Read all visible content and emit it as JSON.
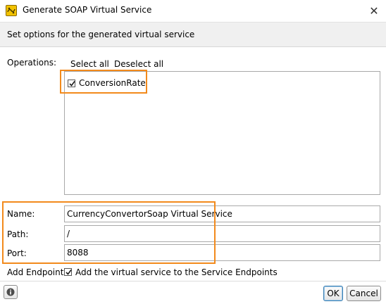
{
  "window": {
    "title": "Generate SOAP Virtual Service",
    "close_glyph": "✕"
  },
  "header": {
    "subtitle": "Set options for the generated virtual service"
  },
  "operations": {
    "label": "Operations:",
    "select_all": "Select all",
    "deselect_all": "Deselect all",
    "items": [
      {
        "label": "ConversionRate",
        "checked": true
      }
    ]
  },
  "form": {
    "name_label": "Name:",
    "name_value": "CurrencyConvertorSoap Virtual Service",
    "path_label": "Path:",
    "path_value": "/",
    "port_label": "Port:",
    "port_value": "8088",
    "endpoint_label": "Add Endpoint:",
    "endpoint_checkbox_label": "Add the virtual service to the Service Endpoints",
    "endpoint_checked": true
  },
  "footer": {
    "ok_label": "OK",
    "cancel_label": "Cancel",
    "info_icon": "info-icon"
  },
  "colors": {
    "highlight": "#f28a1c",
    "header_band": "#f0f0f0",
    "app_icon": "#f2c200"
  }
}
